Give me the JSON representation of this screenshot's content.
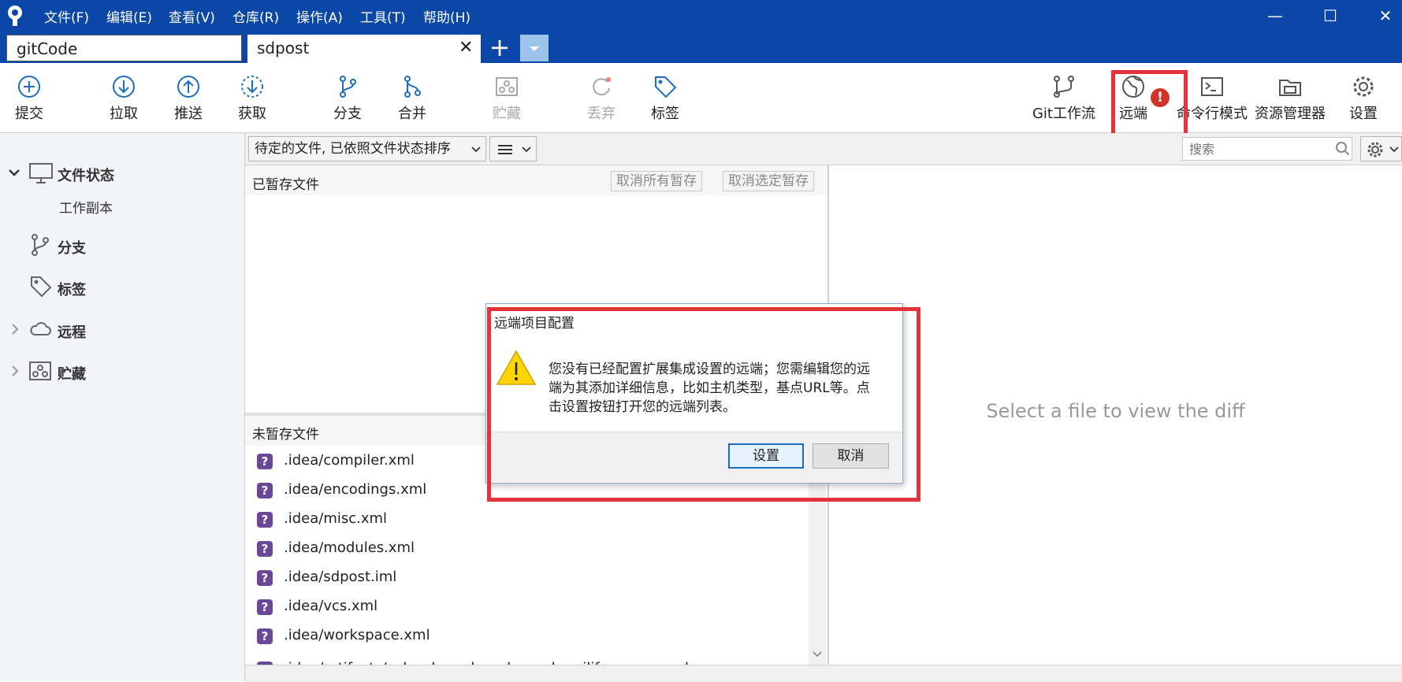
{
  "window": {
    "menu": [
      "文件(F)",
      "编辑(E)",
      "查看(V)",
      "仓库(R)",
      "操作(A)",
      "工具(T)",
      "帮助(H)"
    ],
    "controls": {
      "minimize": "—",
      "maximize": "☐",
      "close": "✕"
    }
  },
  "tabs": [
    {
      "label": "gitCode"
    },
    {
      "label": "sdpost",
      "close": "✕"
    }
  ],
  "tab_add": "+",
  "toolbar": {
    "commit": "提交",
    "pull": "拉取",
    "push": "推送",
    "fetch": "获取",
    "branch": "分支",
    "merge": "合并",
    "stash": "贮藏",
    "discard": "丢弃",
    "tag": "标签",
    "gitflow": "Git工作流",
    "remote": "远端",
    "remote_alert": "!",
    "terminal": "命令行模式",
    "explorer": "资源管理器",
    "settings": "设置"
  },
  "sidebar": {
    "file_status": "文件状态",
    "working_copy": "工作副本",
    "branches": "分支",
    "tags": "标签",
    "remotes": "远程",
    "stashes": "贮藏"
  },
  "filter": {
    "sort_label": "待定的文件, 已依照文件状态排序",
    "search_placeholder": "搜索"
  },
  "staged": {
    "title": "已暂存文件",
    "unstage_all": "取消所有暂存",
    "unstage_selected": "取消选定暂存"
  },
  "unstaged": {
    "title": "未暂存文件",
    "files": [
      ".idea/compiler.xml",
      ".idea/encodings.xml",
      ".idea/misc.xml",
      ".idea/modules.xml",
      ".idea/sdpost.iml",
      ".idea/vcs.xml",
      ".idea/workspace.xml",
      ".idea/artifacts/suborder_edyp_channel_weilifang_war.xml"
    ]
  },
  "diff": {
    "placeholder": "Select a file to view the diff"
  },
  "dialog": {
    "title": "远端项目配置",
    "message_lines": [
      "您没有已经配置扩展集成设置的远端；您需编辑您的远",
      "端为其添加详细信息，比如主机类型，基点URL等。点",
      "击设置按钮打开您的远端列表。"
    ],
    "ok": "设置",
    "cancel": "取消"
  },
  "colors": {
    "title_bar": "#0a47a6",
    "accent_blue": "#1b6ec2",
    "highlight_red": "#e5333b",
    "untracked_icon": "#6a4797",
    "warning_yellow": "#ffd500"
  }
}
